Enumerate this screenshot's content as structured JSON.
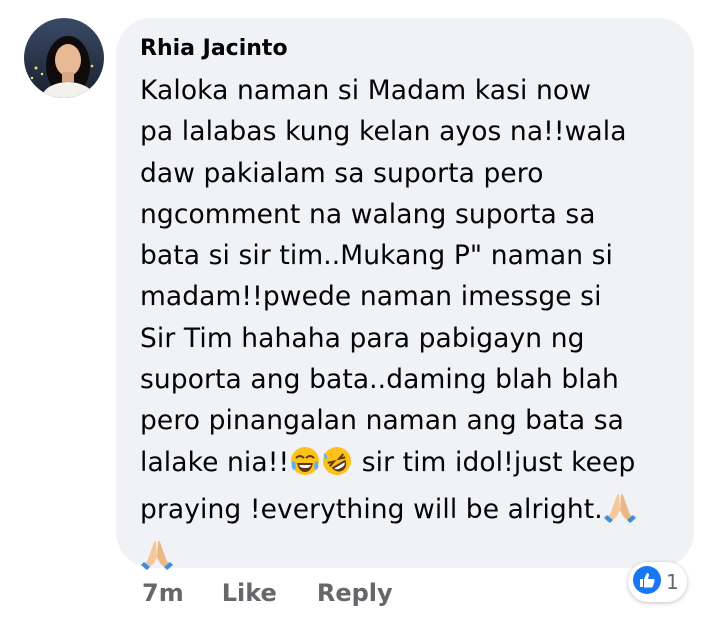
{
  "comment": {
    "author": "Rhia Jacinto",
    "text_lines": [
      "Kaloka naman si Madam kasi now",
      "pa lalabas kung kelan ayos na!!wala",
      "daw pakialam sa suporta pero",
      "ngcomment na walang suporta sa",
      "bata si sir tim..Mukang P\"  naman si",
      "madam!!pwede naman imessge si",
      "Sir Tim hahaha para pabigayn ng",
      "suporta ang bata..daming blah blah",
      "pero pinangalan naman ang bata sa",
      "lalake nia!!",
      " sir tim idol!just keep",
      "praying !everything will be alright."
    ],
    "emojis": [
      "face-with-tears-of-joy-icon",
      "rolling-on-floor-laughing-icon",
      "folded-hands-icon",
      "folded-hands-icon"
    ]
  },
  "actions": {
    "timestamp": "7m",
    "like_label": "Like",
    "reply_label": "Reply"
  },
  "reactions": {
    "icon": "like-icon",
    "count": "1",
    "color": "#1877f2"
  },
  "colors": {
    "bubble": "#f0f2f5",
    "secondary_text": "#65676b"
  }
}
